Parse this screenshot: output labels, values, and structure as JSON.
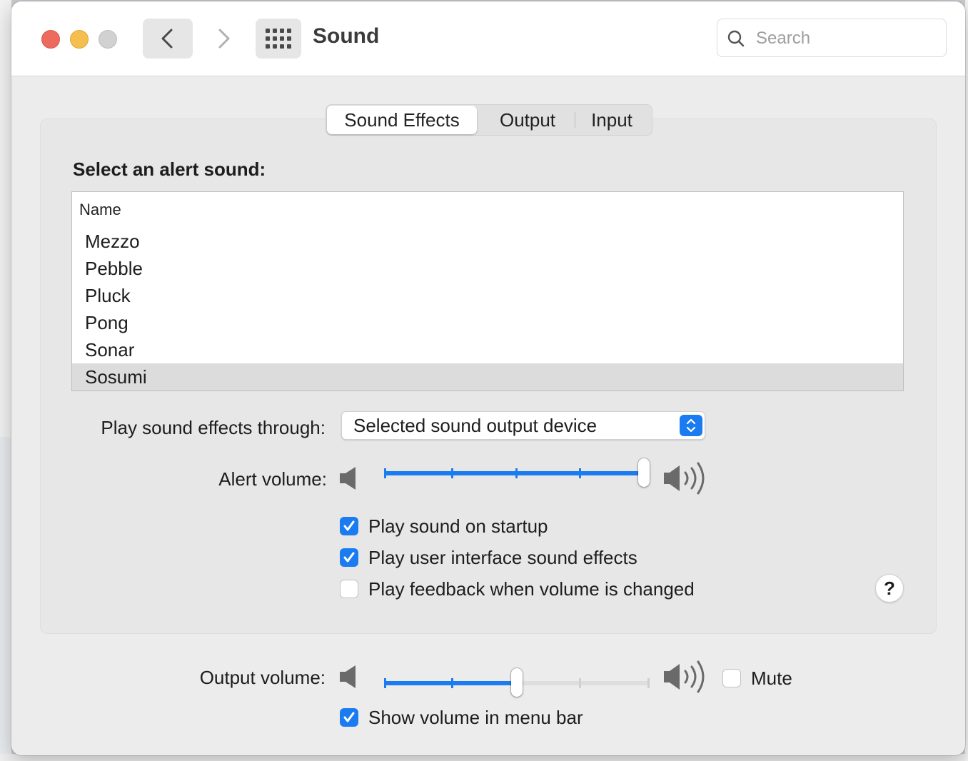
{
  "window": {
    "title": "Sound"
  },
  "search": {
    "placeholder": "Search"
  },
  "tabs": [
    {
      "label": "Sound Effects",
      "selected": true
    },
    {
      "label": "Output",
      "selected": false
    },
    {
      "label": "Input",
      "selected": false
    }
  ],
  "sound_effects": {
    "section_label": "Select an alert sound:",
    "list_header": "Name",
    "sounds": [
      "Mezzo",
      "Pebble",
      "Pluck",
      "Pong",
      "Sonar",
      "Sosumi"
    ],
    "selected_sound": "Sosumi",
    "play_through_label": "Play sound effects through:",
    "play_through_value": "Selected sound output device",
    "alert_volume_label": "Alert volume:",
    "alert_volume": 1.0,
    "checkboxes": [
      {
        "label": "Play sound on startup",
        "checked": true
      },
      {
        "label": "Play user interface sound effects",
        "checked": true
      },
      {
        "label": "Play feedback when volume is changed",
        "checked": false
      }
    ],
    "help_label": "?"
  },
  "output_volume": {
    "label": "Output volume:",
    "value": 0.5,
    "mute_label": "Mute",
    "mute_checked": false,
    "show_in_menu_bar_label": "Show volume in menu bar",
    "show_in_menu_bar_checked": true
  },
  "icons": {
    "close": "close-dot",
    "minimize": "minimize-dot",
    "zoom": "zoom-dot",
    "back": "chevron-left-icon",
    "forward": "chevron-right-icon",
    "grid": "grid-icon",
    "search": "search-icon",
    "speaker_low": "speaker-low-icon",
    "speaker_high": "speaker-high-icon"
  },
  "colors": {
    "accent": "#1a7cf0",
    "close": "#ed6a5e",
    "minimize": "#f5bf4f",
    "zoom": "#d1d1d1"
  }
}
